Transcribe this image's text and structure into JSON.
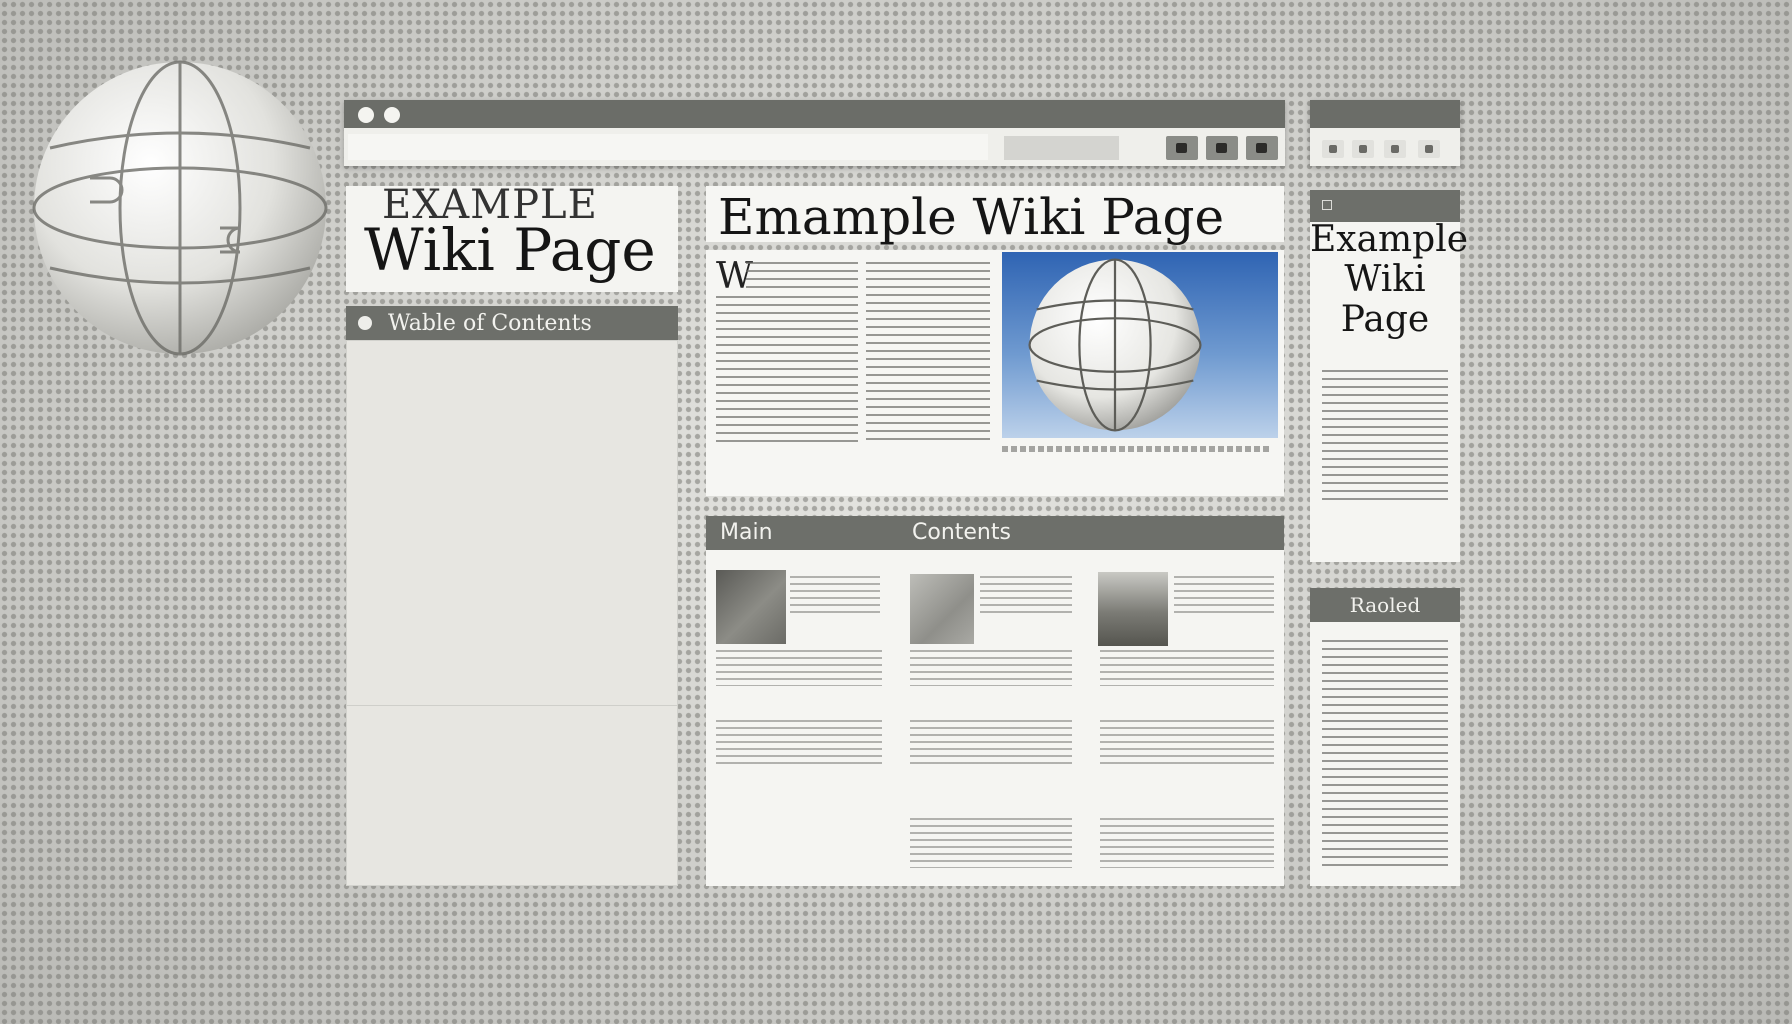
{
  "page": {
    "left_title_small": "EXAMPLE",
    "left_title_big": "Wiki Page",
    "toc_label": "Wable of Contents",
    "article_title": "Emample Wiki Page",
    "dropcap": "W",
    "main_label_1": "Main",
    "main_label_2": "Contents",
    "right_title": "Example Wiki Page",
    "right_panel2_label": "Raoled"
  },
  "icons": {
    "globe": "puzzle-globe-icon",
    "toolbar": [
      "square-icon",
      "square-icon",
      "square-icon"
    ]
  },
  "colors": {
    "panel_header": "#6d6f6a",
    "panel_bg": "#f5f5f2",
    "sky_top": "#2f64b3"
  }
}
